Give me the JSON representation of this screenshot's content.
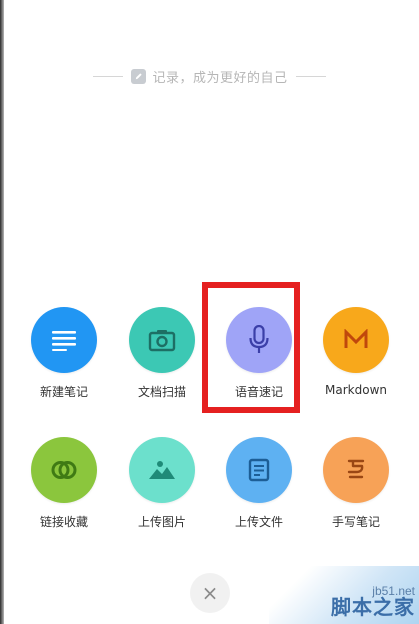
{
  "header": {
    "slogan": "记录，成为更好的自己"
  },
  "actions_row1": [
    {
      "label": "新建笔记",
      "icon": "document-lines-icon",
      "color": "#2196f3"
    },
    {
      "label": "文档扫描",
      "icon": "camera-icon",
      "color": "#3cc8b4"
    },
    {
      "label": "语音速记",
      "icon": "microphone-icon",
      "color": "#9fa4f7"
    },
    {
      "label": "Markdown",
      "icon": "markdown-m-icon",
      "color": "#f8a81b"
    }
  ],
  "actions_row2": [
    {
      "label": "链接收藏",
      "icon": "link-icon",
      "color": "#8bc63d"
    },
    {
      "label": "上传图片",
      "icon": "image-icon",
      "color": "#6ce0cc"
    },
    {
      "label": "上传文件",
      "icon": "file-icon",
      "color": "#5eb1f2"
    },
    {
      "label": "手写笔记",
      "icon": "handwriting-icon",
      "color": "#f7a257"
    }
  ],
  "close": {
    "glyph": "×"
  },
  "watermark": {
    "url": "jb51.net",
    "name": "脚本之家"
  },
  "colors": {
    "highlight": "#e52020",
    "label_text": "#333333",
    "slogan_text": "#b6b6b6"
  }
}
